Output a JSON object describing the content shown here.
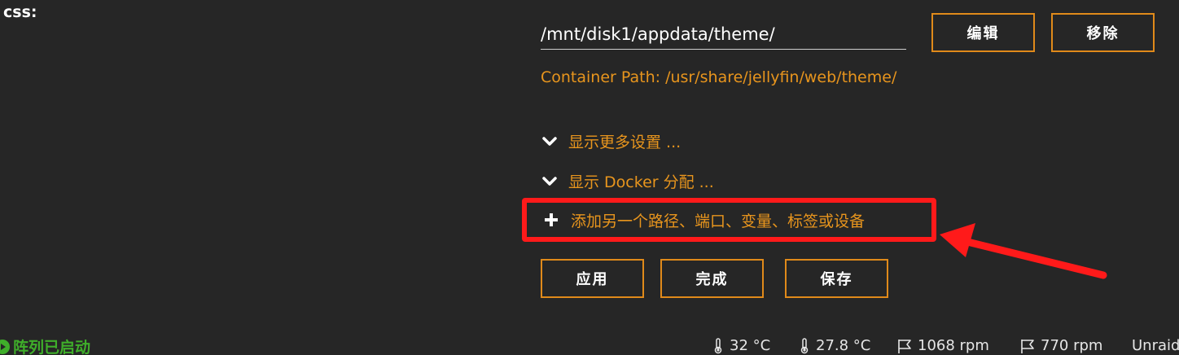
{
  "section": {
    "label": "css:"
  },
  "host_path": {
    "value": "/mnt/disk1/appdata/theme/"
  },
  "buttons": {
    "edit": "编辑",
    "remove": "移除",
    "apply": "应用",
    "done": "完成",
    "save": "保存"
  },
  "container_path": "Container Path: /usr/share/jellyfin/web/theme/",
  "toggles": {
    "more_settings": "显示更多设置 ...",
    "docker_alloc": "显示 Docker 分配 ..."
  },
  "add_link": "添加另一个路径、端口、变量、标签或设备",
  "footer": {
    "array_status": "阵列已启动",
    "cpu_temp": "32 °C",
    "mb_temp": "27.8 °C",
    "fan1": "1068 rpm",
    "fan2": "770 rpm",
    "brand": "Unraid"
  },
  "colors": {
    "accent": "#e8951d",
    "highlight": "#ff1a1a",
    "status_ok": "#3fae2a",
    "background": "#262626"
  },
  "icons": {
    "toggle": "chevron-down-icon",
    "add": "plus-icon",
    "status": "play-circle-icon",
    "temperature": "thermometer-icon",
    "fan": "flag-icon"
  }
}
